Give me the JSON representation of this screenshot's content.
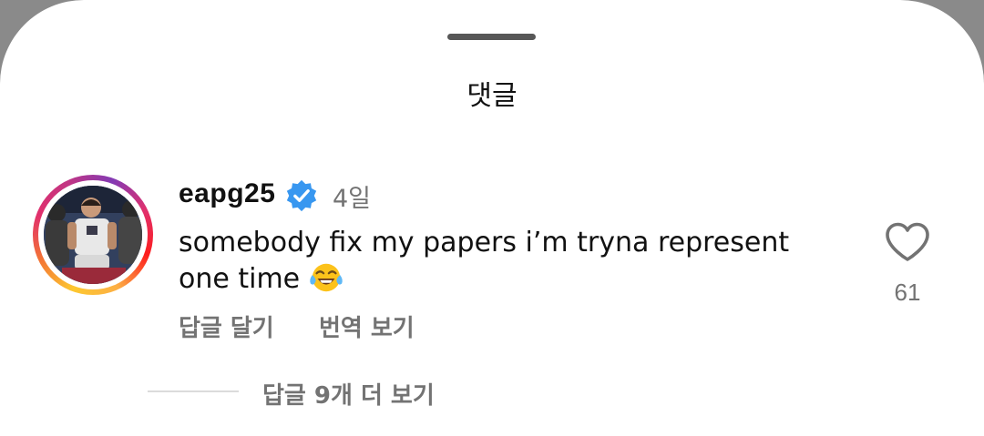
{
  "sheet": {
    "title": "댓글"
  },
  "comment": {
    "username": "eapg25",
    "verified": true,
    "time": "4일",
    "text": "somebody fix my papers i’m tryna represent one time",
    "emoji": "face-with-tears-of-joy",
    "like_count": "61",
    "reply_label": "답글 달기",
    "translate_label": "번역 보기",
    "view_replies_label": "답글 9개 더 보기"
  },
  "icons": {
    "verified_badge": "verified-badge-icon",
    "like": "heart-outline-icon"
  },
  "colors": {
    "primary_text": "#111111",
    "secondary_text": "#737373",
    "verified_blue": "#3897f0",
    "divider": "#dbdbdb"
  }
}
